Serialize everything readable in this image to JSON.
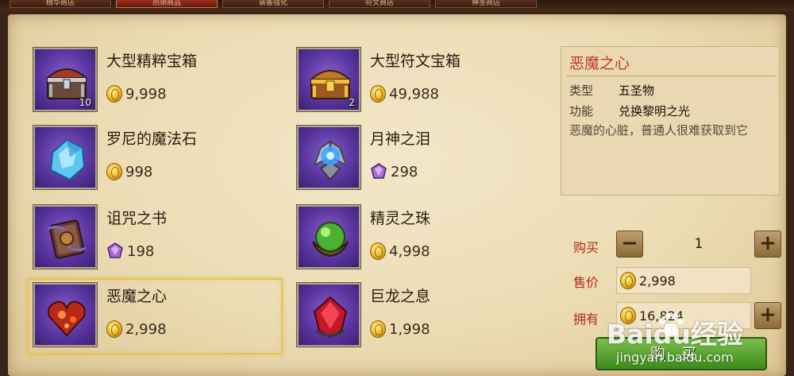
{
  "tabs": [
    {
      "label": "精华商店",
      "active": false
    },
    {
      "label": "热销商品",
      "active": true
    },
    {
      "label": "装备强化",
      "active": false
    },
    {
      "label": "符文商店",
      "active": false
    },
    {
      "label": "神圣商店",
      "active": false
    }
  ],
  "items": [
    {
      "name": "大型精粹宝箱",
      "price": "9,998",
      "currency": "gold",
      "qty": "10",
      "icon": "chest-icon"
    },
    {
      "name": "大型符文宝箱",
      "price": "49,988",
      "currency": "gold",
      "qty": "2",
      "icon": "golden-chest-icon"
    },
    {
      "name": "罗尼的魔法石",
      "price": "998",
      "currency": "gold",
      "qty": "",
      "icon": "blue-crystal-icon"
    },
    {
      "name": "月神之泪",
      "price": "298",
      "currency": "gem",
      "qty": "",
      "icon": "moon-tear-icon"
    },
    {
      "name": "诅咒之书",
      "price": "198",
      "currency": "gem",
      "qty": "",
      "icon": "cursed-book-icon"
    },
    {
      "name": "精灵之珠",
      "price": "4,998",
      "currency": "gold",
      "qty": "",
      "icon": "green-orb-icon"
    },
    {
      "name": "恶魔之心",
      "price": "2,998",
      "currency": "gold",
      "qty": "",
      "icon": "demon-heart-icon",
      "selected": true
    },
    {
      "name": "巨龙之息",
      "price": "1,998",
      "currency": "gold",
      "qty": "",
      "icon": "dragon-breath-icon"
    }
  ],
  "detail": {
    "title": "恶魔之心",
    "type_label": "类型",
    "type_value": "五圣物",
    "func_label": "功能",
    "func_value": "兑换黎明之光",
    "description": "恶魔的心脏，普通人很难获取到它",
    "buy_label": "购买",
    "quantity": "1",
    "price_label": "售价",
    "price_value": "2,998",
    "own_label": "拥有",
    "own_value": "16,824",
    "buy_button": "购买"
  },
  "colors": {
    "accent_red": "#c0392b",
    "buy_green": "#4c9a2a",
    "parchment": "#ecdcb4",
    "icon_purple": "#5a36a0"
  },
  "watermark": {
    "logo": "Baidu经验",
    "url": "jingyan.baidu.com"
  }
}
